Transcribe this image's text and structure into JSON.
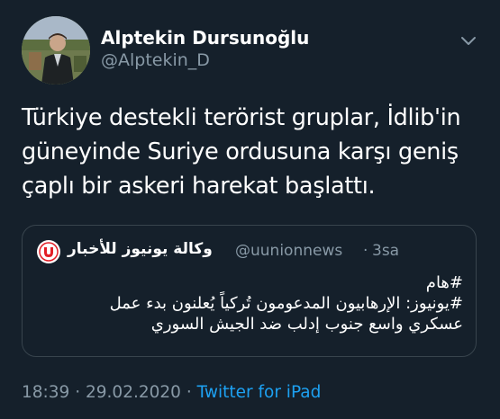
{
  "author": {
    "name": "Alptekin Dursunoğlu",
    "handle": "@Alptekin_D"
  },
  "tweet": {
    "lines": [
      "Türkiye destekli terörist gruplar, İdlib'in",
      "güneyinde Suriye ordusuna karşı geniş",
      "çaplı bir askeri harekat başlattı."
    ]
  },
  "quote": {
    "name": "وكالة يونيوز للأخبار",
    "handle": "@uunionnews",
    "separator": "·",
    "time": "3sa",
    "lines": [
      "#هام",
      "#يونيوز: الإرهابيون المدعومون تُركياً يُعلنون بدء عمل",
      "عسكري واسع جنوب إدلب ضد الجيش السوري"
    ]
  },
  "meta": {
    "time": "18:39",
    "sep1": "·",
    "date": "29.02.2020",
    "sep2": "·",
    "source": "Twitter for iPad"
  },
  "icons": {
    "caret": "chevron-down-icon",
    "avatar": "avatar",
    "quote_avatar": "uunion-logo-icon"
  }
}
